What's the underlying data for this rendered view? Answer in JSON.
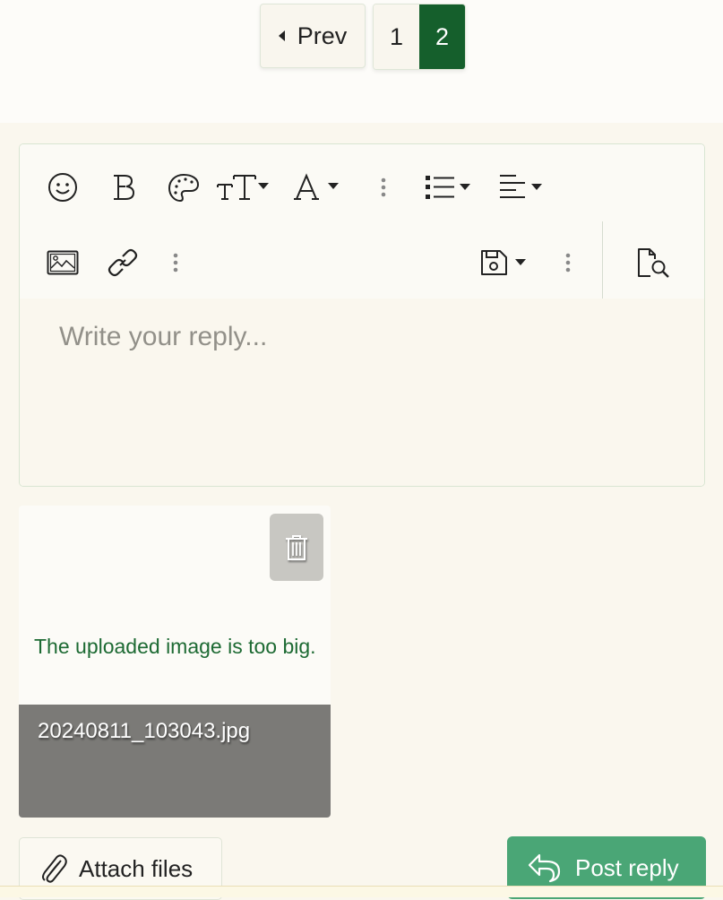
{
  "pagination": {
    "prev_label": "Prev",
    "pages": [
      "1",
      "2"
    ],
    "current_page": "2"
  },
  "editor": {
    "toolbar_row1": [
      "smilie-icon",
      "bold-icon",
      "color-palette-icon",
      "font-size-icon",
      "font-family-icon",
      "more-vertical-icon",
      "list-icon",
      "align-icon"
    ],
    "toolbar_row2": [
      "insert-image-icon",
      "link-icon",
      "more-vertical-icon",
      "save-draft-icon",
      "more-vertical-icon",
      "preview-icon"
    ],
    "placeholder": "Write your reply..."
  },
  "attachment": {
    "error_message": "The uploaded image is too big.",
    "filename": "20240811_103043.jpg"
  },
  "actions": {
    "attach_label": "Attach files",
    "post_label": "Post reply"
  },
  "colors": {
    "accent_dark": "#155f2c",
    "post_button": "#4aa676",
    "error_text": "#1d6a33"
  }
}
